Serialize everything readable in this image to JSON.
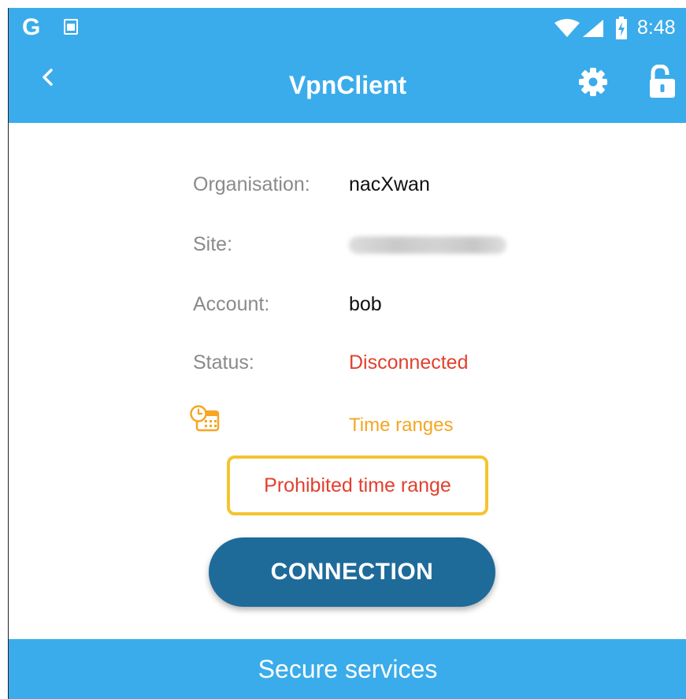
{
  "status_bar": {
    "time": "8:48",
    "left_icons": [
      "google-icon",
      "keyboard-app-icon"
    ],
    "right_icons": [
      "wifi-icon",
      "cell-signal-icon",
      "battery-charging-icon"
    ]
  },
  "appbar": {
    "title": "VpnClient",
    "background_color": "#3AACEB",
    "icons": [
      "back-icon",
      "gear-icon",
      "unlock-icon"
    ]
  },
  "details": {
    "organisation": {
      "label": "Organisation:",
      "value": "nacXwan"
    },
    "site": {
      "label": "Site:",
      "value_visible": "blurred"
    },
    "account": {
      "label": "Account:",
      "value": "bob"
    },
    "status": {
      "label": "Status:",
      "value": "Disconnected",
      "color": "#E2402E"
    }
  },
  "time_ranges": {
    "label": "Time ranges",
    "icon": "calendar-clock-icon",
    "color": "#F5A623"
  },
  "alert": {
    "text": "Prohibited time range",
    "border_color": "#F4C430",
    "text_color": "#E2402E"
  },
  "connect_button": {
    "label": "CONNECTION",
    "color": "#1E6B9A"
  },
  "footer": {
    "label": "Secure services"
  }
}
